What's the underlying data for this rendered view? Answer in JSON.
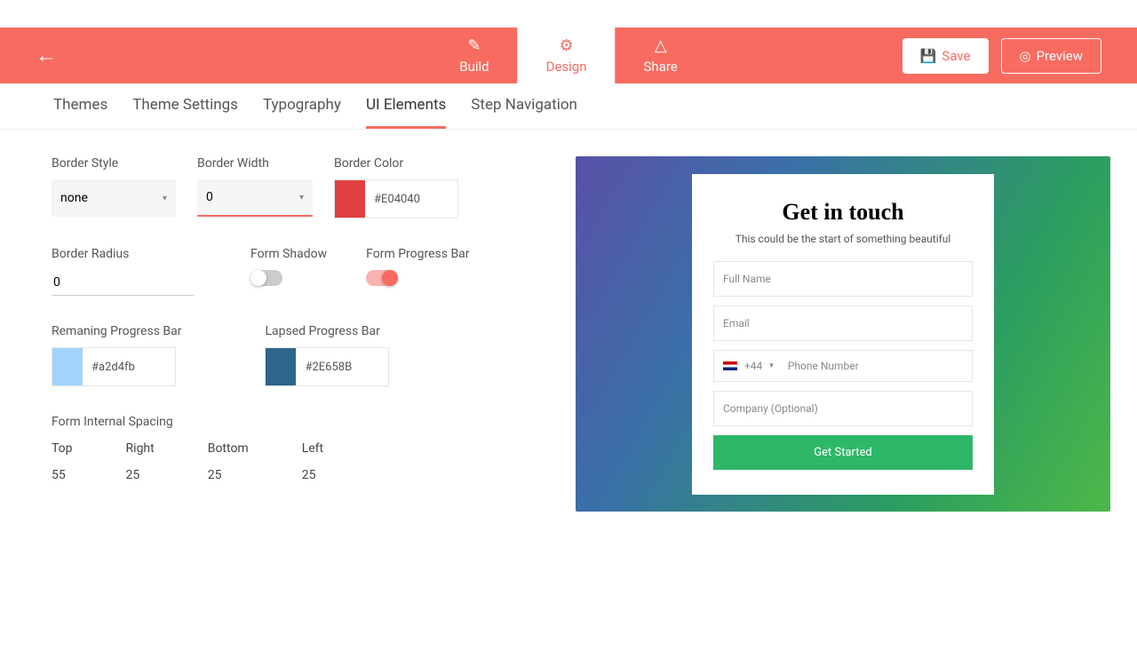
{
  "topbar": {
    "tabs": {
      "build": "Build",
      "design": "Design",
      "share": "Share"
    },
    "save": "Save",
    "preview": "Preview"
  },
  "subnav": {
    "themes": "Themes",
    "theme_settings": "Theme Settings",
    "typography": "Typography",
    "ui_elements": "UI Elements",
    "step_nav": "Step Navigation"
  },
  "fields": {
    "border_style": {
      "label": "Border Style",
      "value": "none"
    },
    "border_width": {
      "label": "Border Width",
      "value": "0"
    },
    "border_color": {
      "label": "Border Color",
      "value": "#E04040",
      "swatch": "#E04040"
    },
    "border_radius": {
      "label": "Border Radius",
      "value": "0"
    },
    "form_shadow": {
      "label": "Form Shadow",
      "on": false
    },
    "progress_bar": {
      "label": "Form Progress Bar",
      "on": true
    },
    "remaining_pb": {
      "label": "Remaning Progress Bar",
      "value": "#a2d4fb",
      "swatch": "#a2d4fb"
    },
    "lapsed_pb": {
      "label": "Lapsed Progress Bar",
      "value": "#2E658B",
      "swatch": "#2E658B"
    },
    "spacing_title": "Form Internal Spacing",
    "spacing": {
      "top": {
        "label": "Top",
        "value": "55"
      },
      "right": {
        "label": "Right",
        "value": "25"
      },
      "bottom": {
        "label": "Bottom",
        "value": "25"
      },
      "left": {
        "label": "Left",
        "value": "25"
      }
    }
  },
  "preview": {
    "title": "Get in touch",
    "subtitle": "This could be the start of something beautiful",
    "full_name": "Full Name",
    "email": "Email",
    "phone_code": "+44",
    "phone_ph": "Phone Number",
    "company": "Company (Optional)",
    "submit": "Get Started"
  }
}
